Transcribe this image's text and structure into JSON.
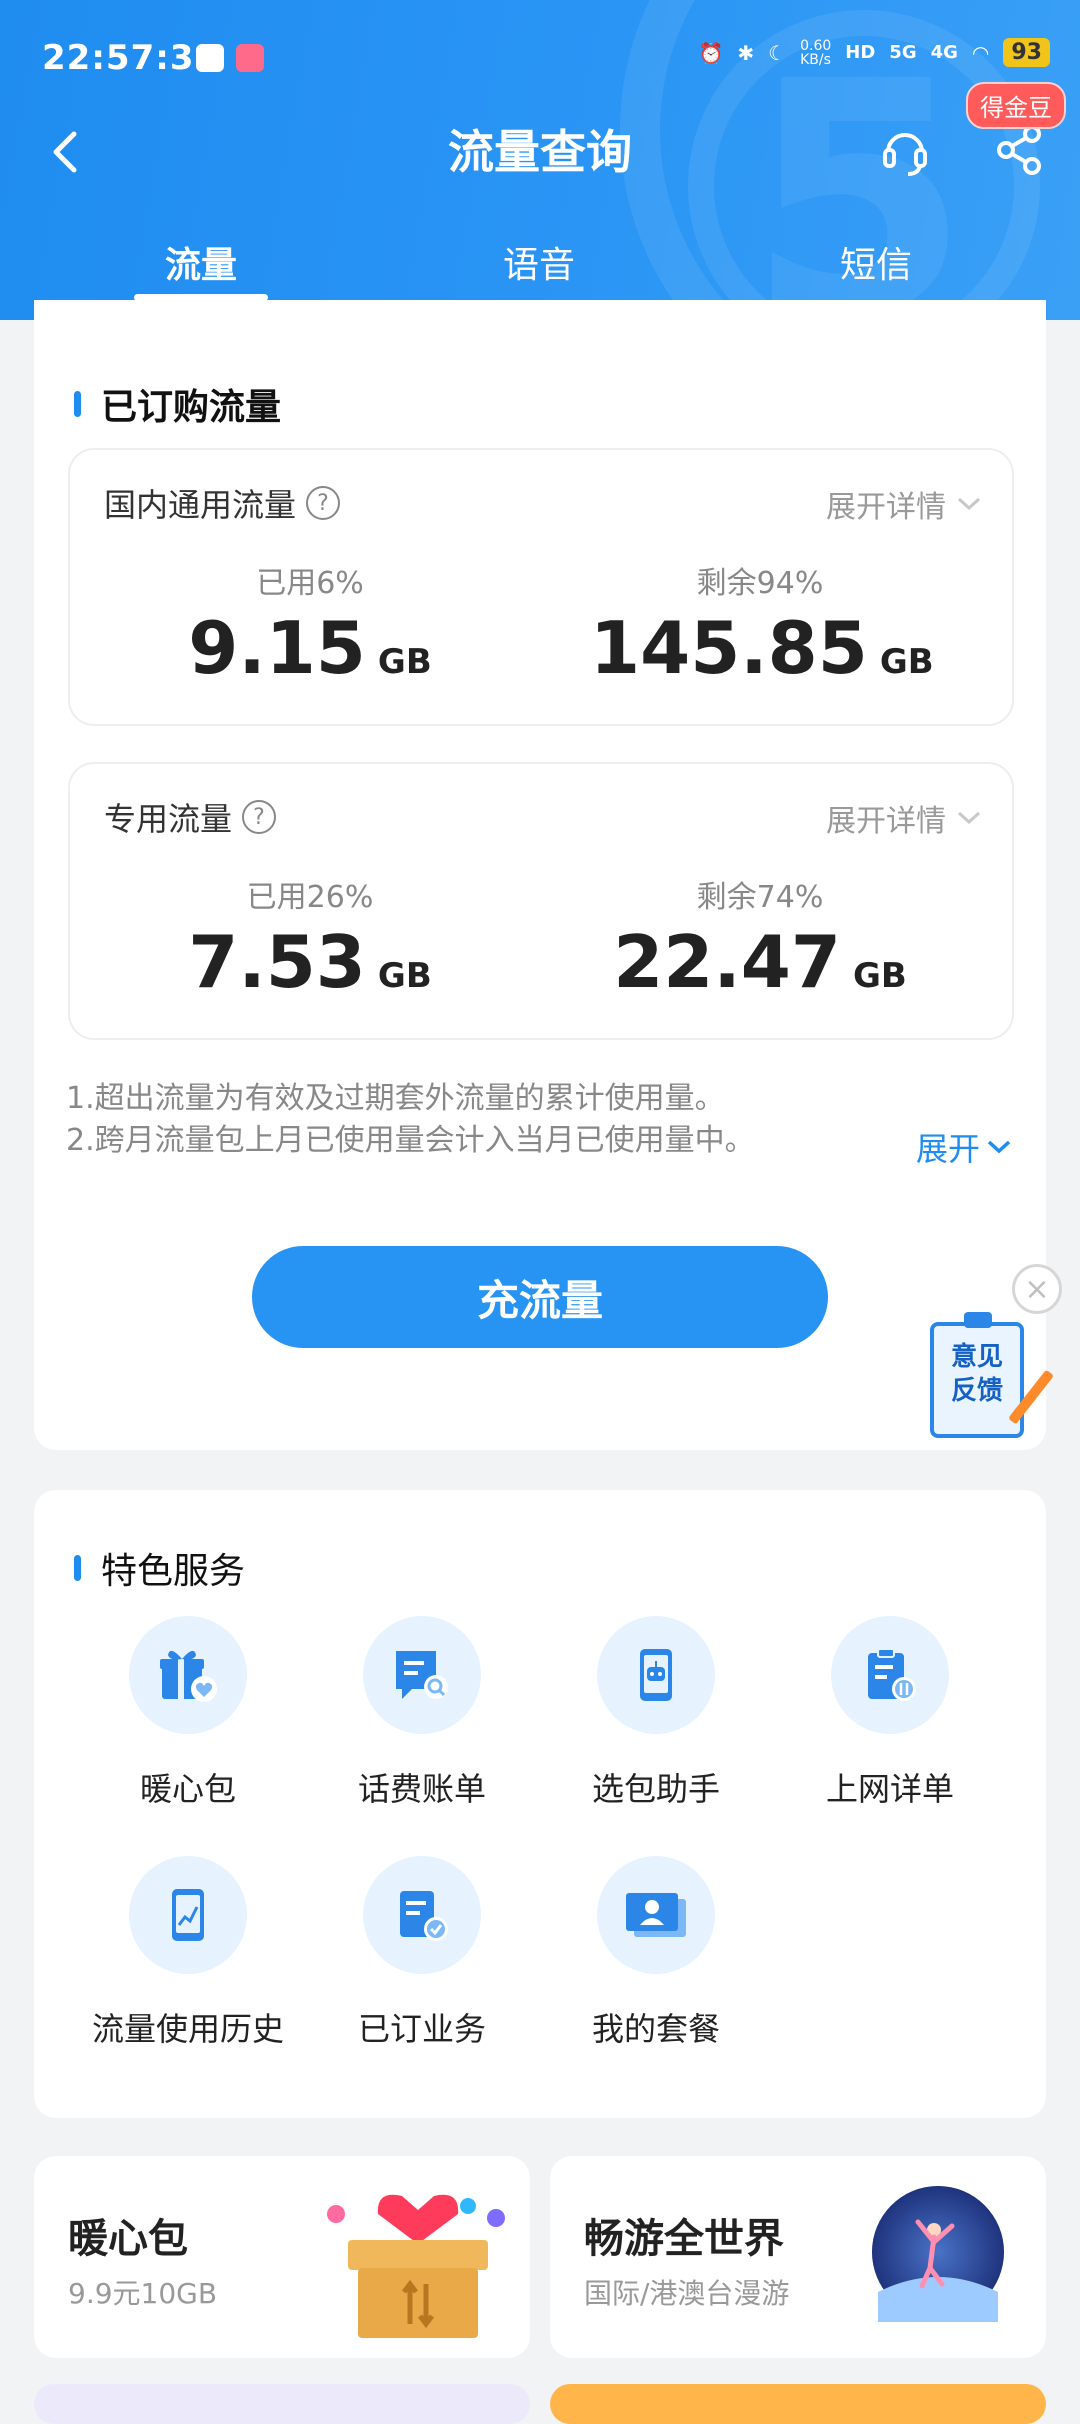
{
  "status_bar": {
    "time": "22:57:34",
    "net_speed": "0.60\nKB/s",
    "hd": "HD",
    "signal1": "5G",
    "signal2": "4G",
    "battery": "93"
  },
  "nav": {
    "title": "流量查询",
    "coin_badge": "得金豆"
  },
  "tabs": [
    "流量",
    "语音",
    "短信"
  ],
  "purchased": {
    "section_title": "已订购流量",
    "domestic": {
      "title": "国内通用流量",
      "expand": "展开详情",
      "used_label": "已用6%",
      "used_value": "9.15",
      "used_unit": "GB",
      "remain_label": "剩余94%",
      "remain_value": "145.85",
      "remain_unit": "GB"
    },
    "dedicated": {
      "title": "专用流量",
      "expand": "展开详情",
      "used_label": "已用26%",
      "used_value": "7.53",
      "used_unit": "GB",
      "remain_label": "剩余74%",
      "remain_value": "22.47",
      "remain_unit": "GB"
    },
    "note1": "1.超出流量为有效及过期套外流量的累计使用量。",
    "note2": "2.跨月流量包上月已使用量会计入当月已使用量中。",
    "note_expand": "展开",
    "cta": "充流量",
    "feedback": [
      "意见",
      "反馈"
    ]
  },
  "features": {
    "section_title": "特色服务",
    "items": [
      {
        "label": "暖心包",
        "icon": "gift-icon"
      },
      {
        "label": "话费账单",
        "icon": "bill-search-icon"
      },
      {
        "label": "选包助手",
        "icon": "robot-phone-icon"
      },
      {
        "label": "上网详单",
        "icon": "clipboard-data-icon"
      },
      {
        "label": "流量使用历史",
        "icon": "phone-chart-icon"
      },
      {
        "label": "已订业务",
        "icon": "document-check-icon"
      },
      {
        "label": "我的套餐",
        "icon": "profile-card-icon"
      }
    ]
  },
  "promos": [
    {
      "title": "暖心包",
      "subtitle": "9.9元10GB"
    },
    {
      "title": "畅游全世界",
      "subtitle": "国际/港澳台漫游"
    }
  ],
  "colors": {
    "brand_blue": "#1f8cf0",
    "badge_red": "#ff5b5b",
    "battery_yellow": "#f0c419"
  }
}
